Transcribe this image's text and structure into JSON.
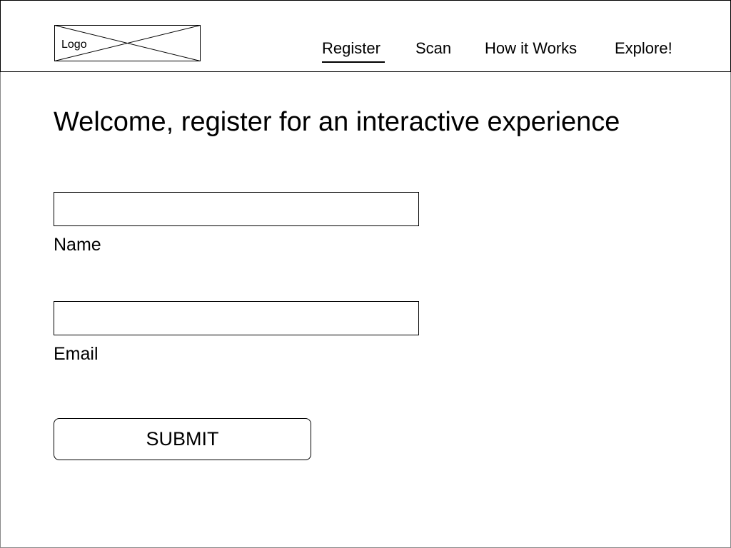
{
  "header": {
    "logo_text": "Logo",
    "nav": [
      {
        "label": "Register",
        "active": true
      },
      {
        "label": "Scan",
        "active": false
      },
      {
        "label": "How it Works",
        "active": false
      },
      {
        "label": "Explore!",
        "active": false
      }
    ]
  },
  "main": {
    "title": "Welcome, register for an interactive experience",
    "form": {
      "name_field": {
        "label": "Name",
        "value": "",
        "placeholder": ""
      },
      "email_field": {
        "label": "Email",
        "value": "",
        "placeholder": ""
      },
      "submit_label": "SUBMIT"
    }
  },
  "colors": {
    "background": "#ffffff",
    "foreground": "#000000",
    "frame_border": "#888888"
  }
}
